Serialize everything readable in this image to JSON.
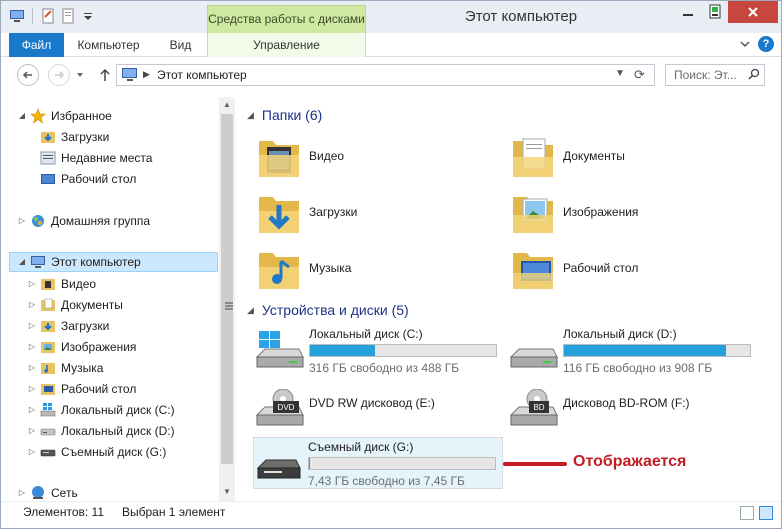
{
  "window": {
    "title": "Этот компьютер",
    "context_tab": "Средства работы с дисками"
  },
  "ribbon": {
    "tabs": [
      "Файл",
      "Компьютер",
      "Вид",
      "Управление"
    ],
    "help": "?"
  },
  "address": {
    "path": "Этот компьютер",
    "search_placeholder": "Поиск: Эт..."
  },
  "nav": {
    "favorites": "Избранное",
    "downloads": "Загрузки",
    "recent": "Недавние места",
    "desktop": "Рабочий стол",
    "homegroup": "Домашняя группа",
    "this_pc": "Этот компьютер",
    "pc_children": [
      "Видео",
      "Документы",
      "Загрузки",
      "Изображения",
      "Музыка",
      "Рабочий стол",
      "Локальный диск (C:)",
      "Локальный диск (D:)",
      "Съемный диск (G:)"
    ],
    "network": "Сеть"
  },
  "content": {
    "folders_header": "Папки (6)",
    "folders": [
      "Видео",
      "Документы",
      "Загрузки",
      "Изображения",
      "Музыка",
      "Рабочий стол"
    ],
    "devices_header": "Устройства и диски (5)",
    "drives": [
      {
        "name": "Локальный диск (C:)",
        "free": "316 ГБ свободно из 488 ГБ",
        "used_fraction": 0.35
      },
      {
        "name": "Локальный диск (D:)",
        "free": "116 ГБ свободно из 908 ГБ",
        "used_fraction": 0.87
      },
      {
        "name": "DVD RW дисковод (E:)",
        "label": "DVD"
      },
      {
        "name": "Дисковод BD-ROM (F:)",
        "label": "BD"
      },
      {
        "name": "Съемный диск (G:)",
        "free": "7,43 ГБ свободно из 7,45 ГБ",
        "used_fraction": 0.003
      }
    ],
    "annotation": "Отображается",
    "accent_color": "#c21d23"
  },
  "status": {
    "count": "Элементов: 11",
    "selected": "Выбран 1 элемент"
  }
}
